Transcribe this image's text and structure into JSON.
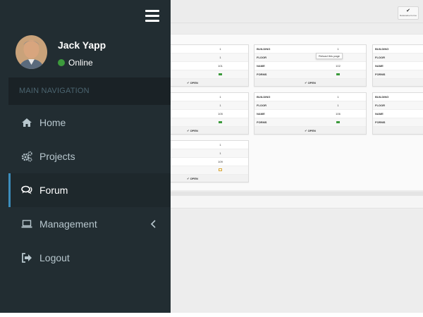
{
  "user": {
    "name": "Jack Yapp",
    "status": "Online"
  },
  "sidebar": {
    "header": "MAIN NAVIGATION",
    "items": [
      {
        "label": "Home",
        "icon": "home-icon"
      },
      {
        "label": "Projects",
        "icon": "cogs-icon"
      },
      {
        "label": "Forum",
        "icon": "comments-icon",
        "active": true
      },
      {
        "label": "Management",
        "icon": "laptop-icon",
        "has_submenu": true
      },
      {
        "label": "Logout",
        "icon": "sign-out-icon"
      }
    ]
  },
  "background": {
    "confirm_button": {
      "icon": "check-icon",
      "label": "Reiterative Forms"
    },
    "tooltip": "Reload this page",
    "card_labels": {
      "building": "BUILDING",
      "floor": "FLOOR",
      "name": "NAME",
      "forms": "FORMS",
      "open": "OPEN"
    },
    "cards": [
      {
        "building": "1",
        "floor": "1",
        "name": "101",
        "forms_status": "complete"
      },
      {
        "building": "1",
        "floor": "1",
        "name": "102",
        "forms_status": "complete"
      },
      {
        "building": "1",
        "floor": "1",
        "name": "105",
        "forms_status": "complete"
      },
      {
        "building": "1",
        "floor": "1",
        "name": "106",
        "forms_status": "complete"
      },
      {
        "building": "1",
        "floor": "1",
        "name": "109",
        "forms_status": "pending"
      }
    ]
  },
  "colors": {
    "sidebar_bg": "#222d32",
    "sidebar_header_bg": "#1a2226",
    "active_accent": "#3c8dbc",
    "online": "#3c9a3c",
    "page_bg": "#ededed"
  }
}
